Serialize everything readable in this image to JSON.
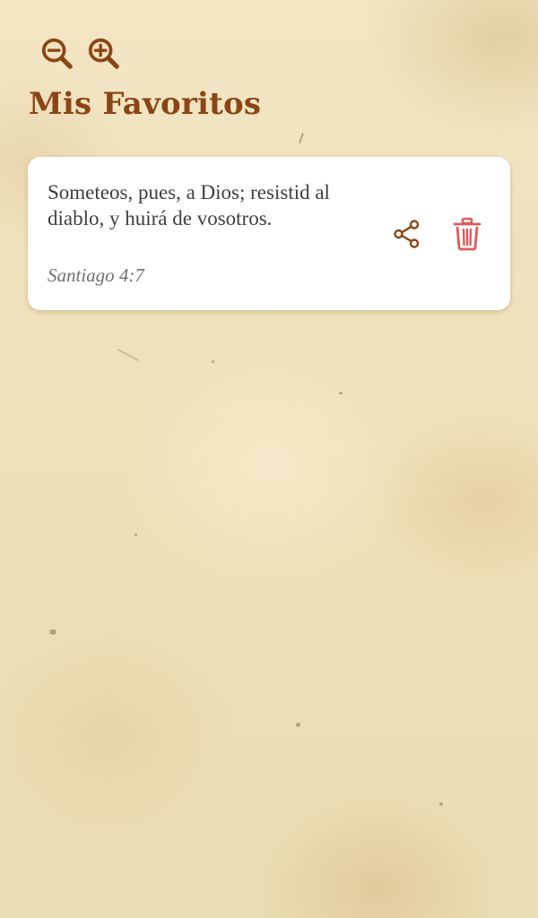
{
  "toolbar": {
    "zoom_out_icon": "zoom-out-icon",
    "zoom_in_icon": "zoom-in-icon",
    "icon_color": "#8a4514"
  },
  "header": {
    "title": "Mis Favoritos",
    "title_color": "#8a4514"
  },
  "favorites": [
    {
      "text": "Someteos, pues, a Dios; resistid al diablo, y huirá de vosotros.",
      "reference": "Santiago 4:7",
      "share_icon": "share-icon",
      "delete_icon": "trash-icon"
    }
  ],
  "colors": {
    "share": "#8a4514",
    "delete": "#e05a5a",
    "card_bg": "#ffffff"
  }
}
